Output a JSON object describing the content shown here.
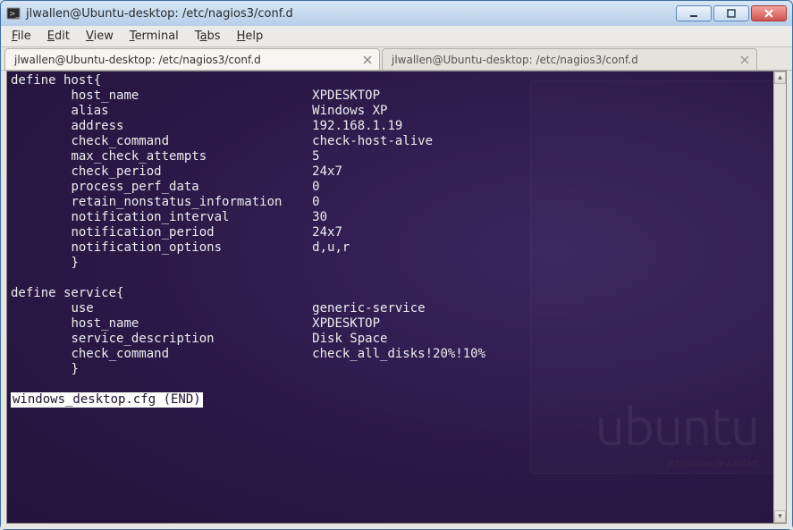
{
  "window": {
    "title": "jlwallen@Ubuntu-desktop: /etc/nagios3/conf.d"
  },
  "menu": {
    "file": "File",
    "edit": "Edit",
    "view": "View",
    "terminal": "Terminal",
    "tabs": "Tabs",
    "help": "Help"
  },
  "tabs": [
    {
      "label": "jlwallen@Ubuntu-desktop: /etc/nagios3/conf.d",
      "active": true
    },
    {
      "label": "jlwallen@Ubuntu-desktop: /etc/nagios3/conf.d",
      "active": false
    }
  ],
  "terminal": {
    "host_block_open": "define host{",
    "host": {
      "host_name": {
        "k": "host_name",
        "v": "XPDESKTOP"
      },
      "alias": {
        "k": "alias",
        "v": "Windows XP"
      },
      "address": {
        "k": "address",
        "v": "192.168.1.19"
      },
      "check_command": {
        "k": "check_command",
        "v": "check-host-alive"
      },
      "max_attempts": {
        "k": "max_check_attempts",
        "v": "5"
      },
      "check_period": {
        "k": "check_period",
        "v": "24x7"
      },
      "process_perf": {
        "k": "process_perf_data",
        "v": "0"
      },
      "retain_nonstatus": {
        "k": "retain_nonstatus_information",
        "v": "0"
      },
      "notif_interval": {
        "k": "notification_interval",
        "v": "30"
      },
      "notif_period": {
        "k": "notification_period",
        "v": "24x7"
      },
      "notif_options": {
        "k": "notification_options",
        "v": "d,u,r"
      }
    },
    "block_close": "}",
    "service_block_open": "define service{",
    "service": {
      "use": {
        "k": "use",
        "v": "generic-service"
      },
      "host_name": {
        "k": "host_name",
        "v": "XPDESKTOP"
      },
      "description": {
        "k": "service_description",
        "v": "Disk Space"
      },
      "check_command": {
        "k": "check_command",
        "v": "check_all_disks!20%!10%"
      }
    },
    "end_line": "windows_desktop.cfg (END)"
  },
  "logo": {
    "word": "ubuntu",
    "credit": "astoyanov.deviantart"
  }
}
